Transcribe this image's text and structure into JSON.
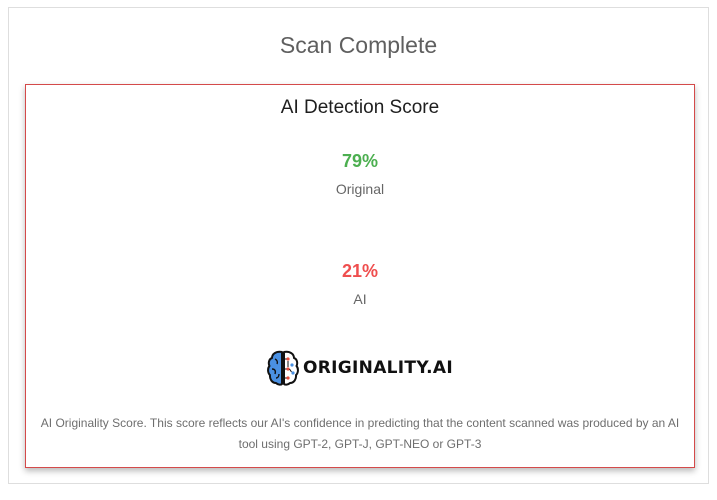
{
  "page": {
    "title": "Scan Complete"
  },
  "card": {
    "title": "AI Detection Score",
    "original": {
      "percent": "79%",
      "label": "Original",
      "color": "#4caf50"
    },
    "ai": {
      "percent": "21%",
      "label": "AI",
      "color": "#ef4e4e"
    },
    "logo": {
      "text": "ORIGINALITY.AI",
      "icon": "brain-icon"
    },
    "footnote": "AI Originality Score. This score reflects our AI's confidence in predicting that the content scanned was produced by an AI tool using GPT-2, GPT-J, GPT-NEO or GPT-3"
  }
}
